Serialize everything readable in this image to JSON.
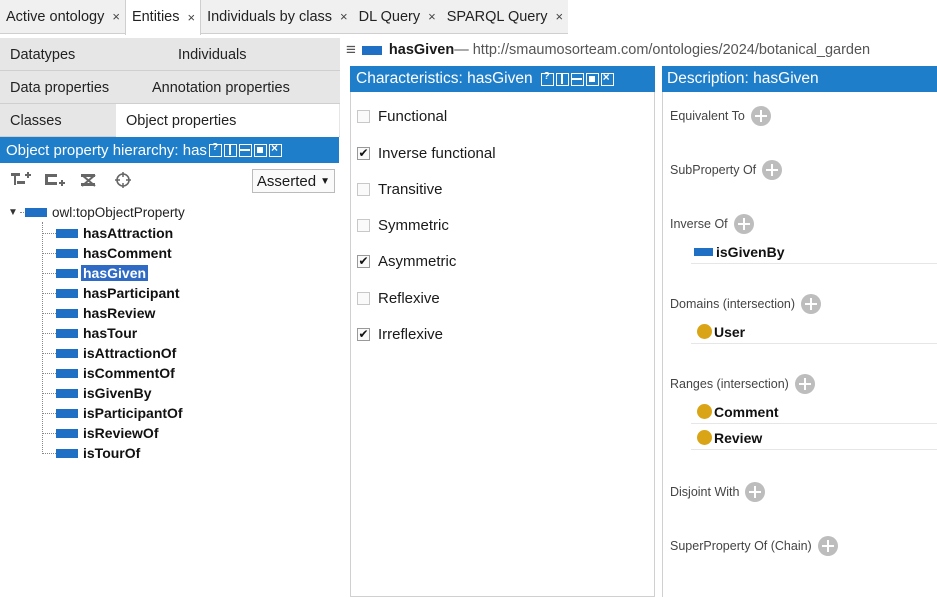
{
  "tabs": [
    {
      "label": "Active ontology",
      "active": false
    },
    {
      "label": "Entities",
      "active": true
    },
    {
      "label": "Individuals by class",
      "active": false
    },
    {
      "label": "DL Query",
      "active": false
    },
    {
      "label": "SPARQL Query",
      "active": false
    }
  ],
  "tab_close_glyph": "×",
  "left": {
    "subtabs_row1": [
      "Datatypes",
      "Individuals"
    ],
    "subtabs_row2": [
      "Data properties",
      "Annotation properties"
    ],
    "subtabs_row3": [
      "Classes",
      "Object properties"
    ],
    "view_title": "Object property hierarchy: has",
    "mode_select": "Asserted",
    "tree_root": "owl:topObjectProperty",
    "tree_items": [
      "hasAttraction",
      "hasComment",
      "hasGiven",
      "hasParticipant",
      "hasReview",
      "hasTour",
      "isAttractionOf",
      "isCommentOf",
      "isGivenBy",
      "isParticipantOf",
      "isReviewOf",
      "isTourOf"
    ],
    "selected": "hasGiven"
  },
  "header": {
    "entity_name": "hasGiven",
    "iri": "— http://smaumosorteam.com/ontologies/2024/botanical_garden"
  },
  "characteristics": {
    "title": "Characteristics: hasGiven",
    "items": [
      {
        "label": "Functional",
        "checked": false
      },
      {
        "label": "Inverse functional",
        "checked": true
      },
      {
        "label": "Transitive",
        "checked": false
      },
      {
        "label": "Symmetric",
        "checked": false
      },
      {
        "label": "Asymmetric",
        "checked": true
      },
      {
        "label": "Reflexive",
        "checked": false
      },
      {
        "label": "Irreflexive",
        "checked": true
      }
    ]
  },
  "description": {
    "title": "Description: hasGiven",
    "equivalent_to": "Equivalent To",
    "subproperty_of": "SubProperty Of",
    "inverse_of": "Inverse Of",
    "inverse_value": "isGivenBy",
    "domains": "Domains (intersection)",
    "domain_values": [
      "User"
    ],
    "ranges": "Ranges (intersection)",
    "range_values": [
      "Comment",
      "Review"
    ],
    "disjoint_with": "Disjoint With",
    "superproperty_chain": "SuperProperty Of (Chain)"
  },
  "colors": {
    "header_blue": "#1f7ec9",
    "property_icon": "#1f6fc4",
    "class_dot": "#d9a516",
    "selection": "#2f6bc5"
  }
}
